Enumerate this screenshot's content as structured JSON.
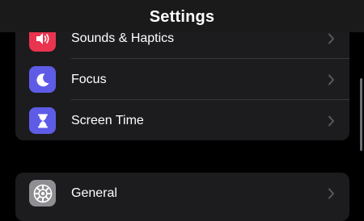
{
  "nav": {
    "title": "Settings"
  },
  "colors": {
    "background": "#000000",
    "group_background": "#1c1c1e",
    "separator": "#38383a",
    "chevron": "#5a5a5e",
    "sounds_tile": "#e9344f",
    "focus_tile": "#5e5ce6",
    "screen_time_tile": "#5e5ce6",
    "general_tile": "#8e8e93"
  },
  "rows": [
    {
      "label": "Sounds & Haptics",
      "icon": "speaker-icon"
    },
    {
      "label": "Focus",
      "icon": "moon-icon"
    },
    {
      "label": "Screen Time",
      "icon": "hourglass-icon"
    },
    {
      "label": "General",
      "icon": "gear-icon"
    }
  ]
}
